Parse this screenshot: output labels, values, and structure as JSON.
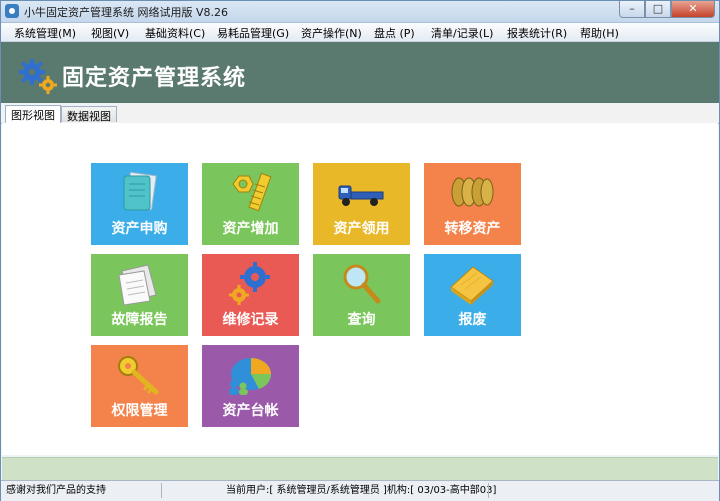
{
  "window": {
    "title": "小牛固定资产管理系统 网络试用版 V8.26",
    "buttons": {
      "minimize": "–",
      "maximize": "□",
      "close": "✕"
    }
  },
  "menu": [
    "系统管理(M)",
    "视图(V)",
    "基础资料(C)",
    "易耗品管理(G)",
    "资产操作(N)",
    "盘点 (P)",
    "清单/记录(L)",
    "报表统计(R)",
    "帮助(H)"
  ],
  "banner": {
    "title": "固定资产管理系统"
  },
  "tabs": [
    {
      "label": "图形视图",
      "active": true
    },
    {
      "label": "数据视图",
      "active": false
    }
  ],
  "tiles": [
    {
      "label": "资产申购",
      "color": "#3baeea",
      "icon": "documents-icon"
    },
    {
      "label": "资产增加",
      "color": "#7bc65c",
      "icon": "bolt-nut-icon"
    },
    {
      "label": "资产领用",
      "color": "#e8b829",
      "icon": "truck-icon"
    },
    {
      "label": "转移资产",
      "color": "#f3834b",
      "icon": "coins-icon"
    },
    {
      "label": "故障报告",
      "color": "#7bc65c",
      "icon": "papers-icon"
    },
    {
      "label": "维修记录",
      "color": "#ea5a54",
      "icon": "gears-icon"
    },
    {
      "label": "查询",
      "color": "#7bc65c",
      "icon": "magnifier-icon"
    },
    {
      "label": "报废",
      "color": "#3baeea",
      "icon": "note-icon"
    },
    {
      "label": "权限管理",
      "color": "#f3834b",
      "icon": "key-icon"
    },
    {
      "label": "资产台帐",
      "color": "#9a5aa9",
      "icon": "pie-chart-icon"
    }
  ],
  "status": {
    "message": "感谢对我们产品的支持",
    "user": "当前用户:[ 系统管理员/系统管理员 ]机构:[ 03/03-高中部03]"
  }
}
